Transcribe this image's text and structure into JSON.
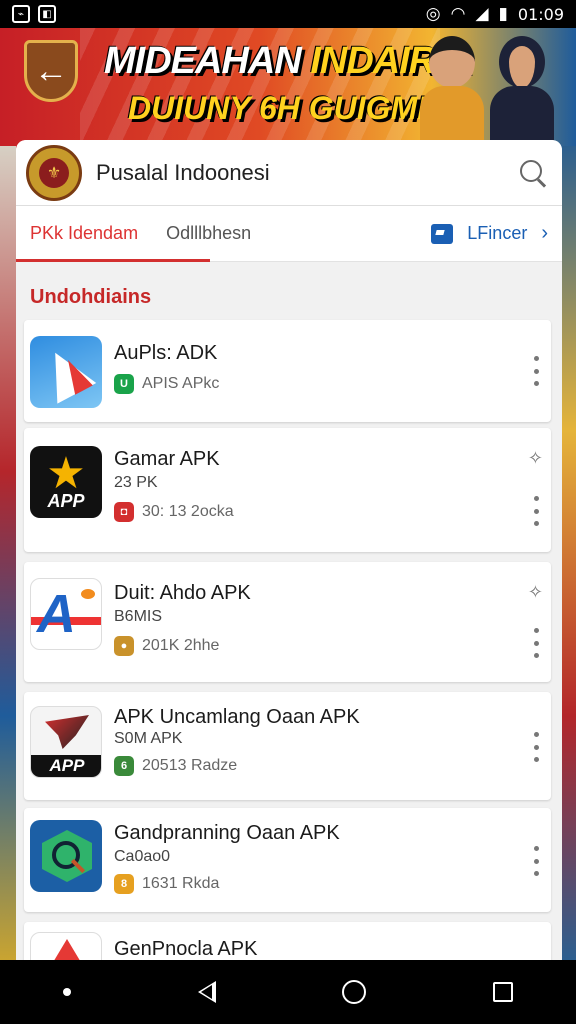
{
  "status_bar": {
    "time": "01:09",
    "left_icons": [
      "app-badge-icon",
      "notification-icon"
    ],
    "right_icons": [
      "hotspot-icon",
      "wifi-icon",
      "signal-icon",
      "battery-icon"
    ]
  },
  "banner": {
    "line1_a": "MIDEAHAN",
    "line1_b": "INDAIRIA",
    "line2": "DUIUNY 6H GUIGMPAL",
    "back_icon": "back-arrow-icon"
  },
  "header": {
    "title": "Pusalal Indoonesi",
    "search_icon": "search-icon"
  },
  "tabs": {
    "items": [
      {
        "label": "PKk Idendam"
      },
      {
        "label": "Odlllbhesn"
      }
    ],
    "right_label": "LFincer",
    "right_chevron": "›"
  },
  "section": {
    "title": "Undohdiains"
  },
  "apps": [
    {
      "name": "AuPls: ADK",
      "sub": "",
      "meta": "APIS APkc",
      "badge_color": "#1aa34a",
      "badge_text": "U"
    },
    {
      "name": "Gamar APK",
      "sub": "23 PK",
      "meta": "30: 13 2ocka",
      "badge_color": "#d32f2f",
      "badge_text": "◘"
    },
    {
      "name": "Duit: Ahdo APK",
      "sub": "B6MIS",
      "meta": "201K 2hhe",
      "badge_color": "#c9922b",
      "badge_text": "●"
    },
    {
      "name": "APK Uncamlang Oaan APK",
      "sub": "S0M APK",
      "meta": "20513 Radze",
      "badge_color": "#3a8a3a",
      "badge_text": "6"
    },
    {
      "name": "Gandpranning Oaan APK",
      "sub": "Ca0ao0",
      "meta": "1631 Rkda",
      "badge_color": "#e6a020",
      "badge_text": "8"
    },
    {
      "name": "GenPnocla APK",
      "sub": "",
      "meta": "",
      "badge_color": "#999999",
      "badge_text": ""
    }
  ],
  "navbar": {
    "icons": [
      "dot-icon",
      "back-icon",
      "home-icon",
      "recents-icon"
    ]
  }
}
